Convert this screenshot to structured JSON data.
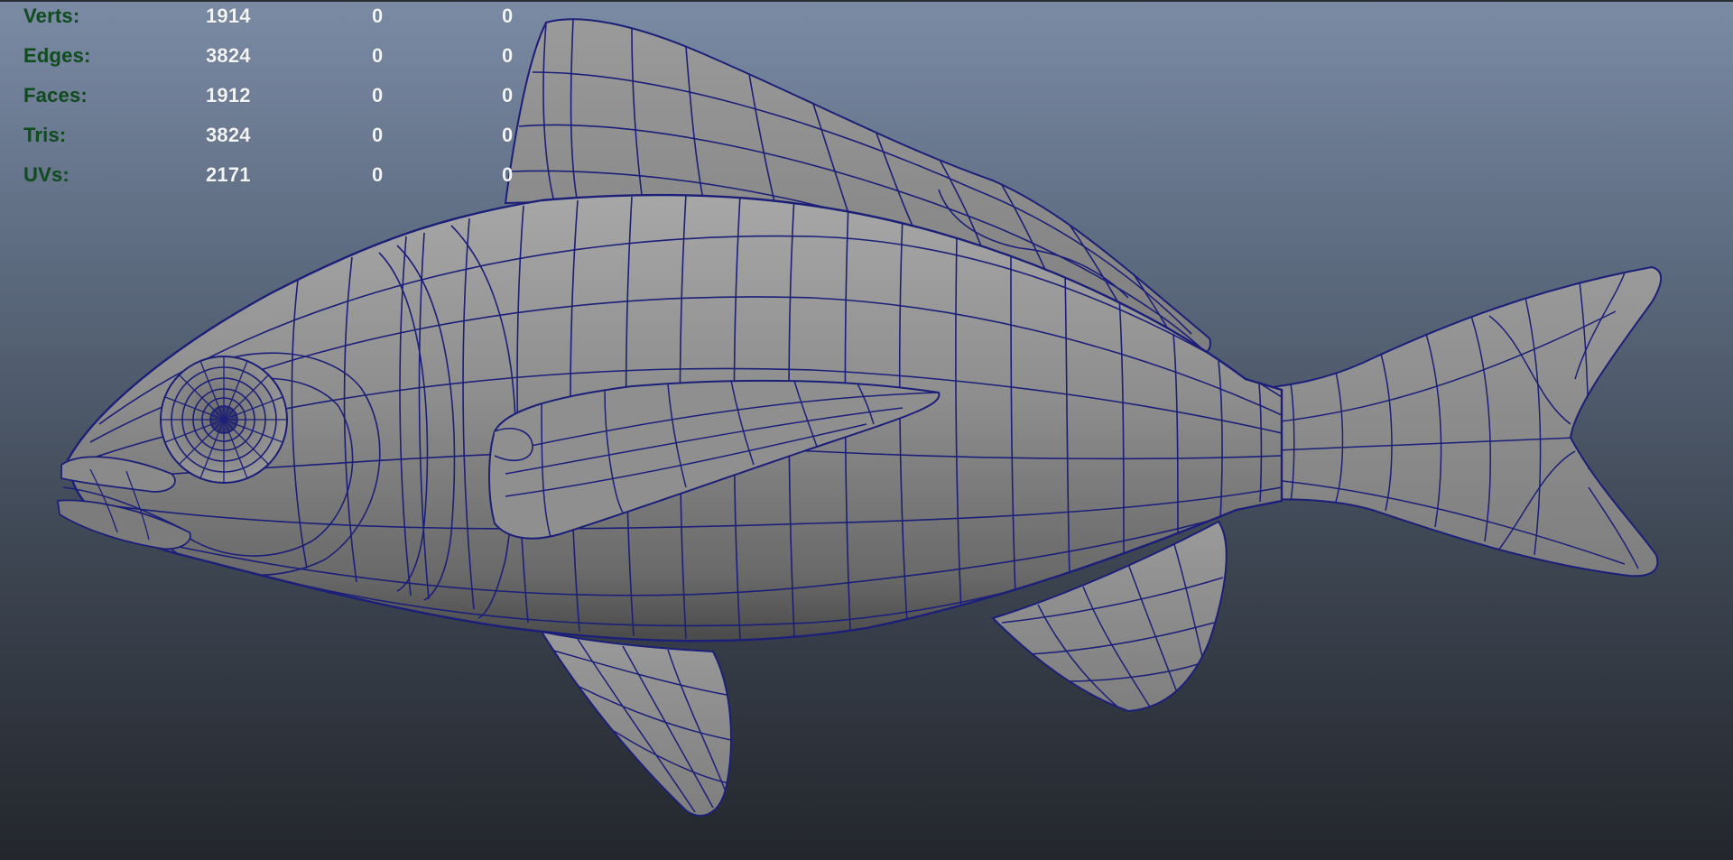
{
  "heads_up_display": {
    "rows": [
      {
        "label": "Verts:",
        "total": "1914",
        "selected": "0",
        "selected_extra": "0"
      },
      {
        "label": "Edges:",
        "total": "3824",
        "selected": "0",
        "selected_extra": "0"
      },
      {
        "label": "Faces:",
        "total": "1912",
        "selected": "0",
        "selected_extra": "0"
      },
      {
        "label": "Tris:",
        "total": "3824",
        "selected": "0",
        "selected_extra": "0"
      },
      {
        "label": "UVs:",
        "total": "2171",
        "selected": "0",
        "selected_extra": "0"
      }
    ]
  },
  "colors": {
    "wireframe": "#1c1f78",
    "label_green": "#0f4d1e",
    "value_white": "#f2f4f6",
    "surface_grey": "#8c8c8c"
  },
  "viewport": {
    "object": "fish-mesh",
    "display_mode": "wireframe-on-shaded"
  }
}
